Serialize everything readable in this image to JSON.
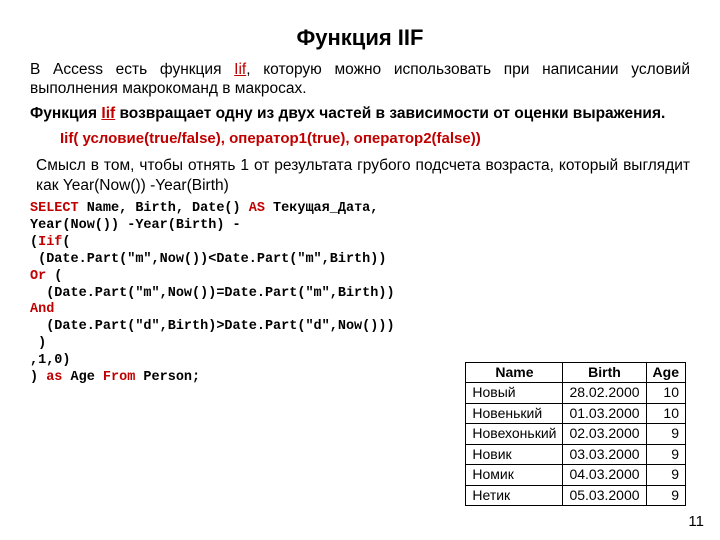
{
  "title": "Функция IIF",
  "para1_a": "В Access есть функция ",
  "para1_func": "Iif",
  "para1_b": ", которую можно использовать при написании условий выполнения макрокоманд в макросах.",
  "para2_a": "Функция ",
  "para2_func": "Iif",
  "para2_b": " возвращает одну из двух частей в зависимости от оценки выражения.",
  "syntax": "Iif( условие(true/false), оператор1(true), оператор2(false))",
  "para3": "Смысл в том, чтобы отнять 1 от результата грубого подсчета возраста, который выглядит как Year(Now()) -Year(Birth)",
  "code": {
    "kw_select": "SELECT",
    "l1_rest": " Name, Birth, Date() ",
    "kw_as1": "AS",
    "l1_tail": " Текущая_Дата,",
    "l2": "Year(Now()) -Year(Birth) -",
    "l3_a": "(",
    "kw_iif": "Iif",
    "l3_b": "(",
    "l4": " (Date.Part(\"m\",Now())<Date.Part(\"m\",Birth))",
    "kw_or": "Or",
    "l5": " (",
    "l6": "  (Date.Part(\"m\",Now())=Date.Part(\"m\",Birth))",
    "kw_and": "And",
    "l7": "  (Date.Part(\"d\",Birth)>Date.Part(\"d\",Now()))",
    "l8": " )",
    "l9": ",1,0)",
    "l10_a": ") ",
    "kw_as2": "as",
    "l10_b": " Age ",
    "kw_from": "From",
    "l10_c": " Person;"
  },
  "table": {
    "headers": [
      "Name",
      "Birth",
      "Age"
    ],
    "rows": [
      [
        "Новый",
        "28.02.2000",
        "10"
      ],
      [
        "Новенький",
        "01.03.2000",
        "10"
      ],
      [
        "Новехонький",
        "02.03.2000",
        "9"
      ],
      [
        "Новик",
        "03.03.2000",
        "9"
      ],
      [
        "Номик",
        "04.03.2000",
        "9"
      ],
      [
        "Нетик",
        "05.03.2000",
        "9"
      ]
    ]
  },
  "page": "11"
}
